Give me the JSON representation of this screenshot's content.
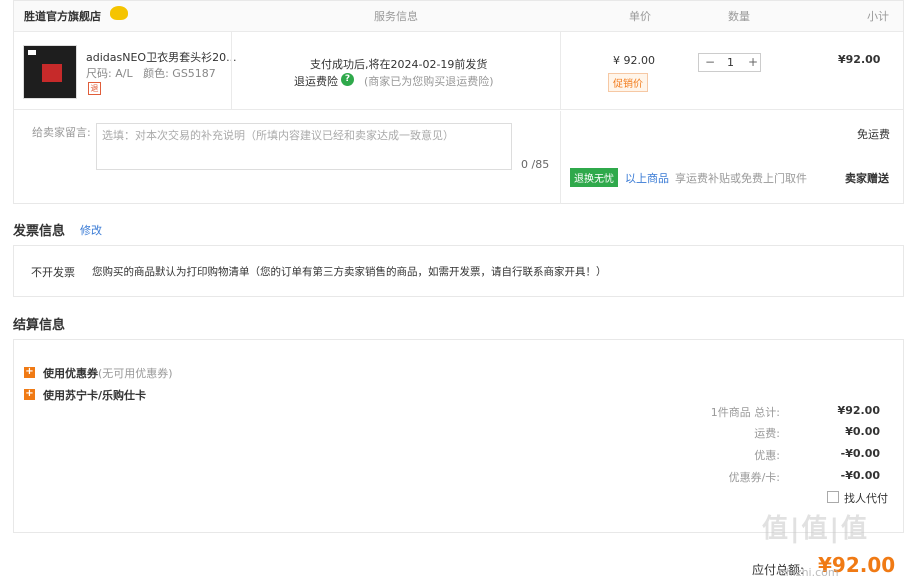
{
  "header": {
    "store_name": "胜道官方旗舰店",
    "col_service": "服务信息",
    "col_price": "单价",
    "col_qty": "数量",
    "col_subtotal": "小计"
  },
  "item": {
    "title": "adidasNEO卫衣男套头衫20...",
    "size_label": "尺码:",
    "size_value": "A/L",
    "color_label": "颜色:",
    "color_value": "GS5187",
    "return_tag": "退",
    "ship_notice": "支付成功后,将在2024-02-19前发货",
    "insurance_label": "退运费险",
    "insurance_note": "(商家已为您购买退运费险)",
    "price": "¥ 92.00",
    "promo_tag": "促销价",
    "qty": "1",
    "qty_minus": "−",
    "qty_plus": "+",
    "subtotal": "¥92.00"
  },
  "message": {
    "label": "给卖家留言:",
    "placeholder": "选填：对本次交易的补充说明（所填内容建议已经和卖家达成一致意见）",
    "counter": "0 /85",
    "shipping": "免运费",
    "green_tag": "退换无忧",
    "tag_link": "以上商品",
    "tag_desc": "享运费补贴或免费上门取件",
    "gift": "卖家赠送"
  },
  "invoice": {
    "title": "发票信息",
    "edit": "修改",
    "status": "不开发票",
    "note": "您购买的商品默认为打印购物清单（您的订单有第三方卖家销售的商品，如需开发票，请自行联系商家开具！）"
  },
  "settlement": {
    "title": "结算信息",
    "coupon_label": "使用优惠券",
    "coupon_note": "(无可用优惠券)",
    "card_label": "使用苏宁卡/乐购仕卡",
    "rows": [
      {
        "label": "1件商品 总计:",
        "value": "¥92.00"
      },
      {
        "label": "运费:",
        "value": "¥0.00"
      },
      {
        "label": "优惠:",
        "value": "-¥0.00"
      },
      {
        "label": "优惠券/卡:",
        "value": "-¥0.00"
      }
    ],
    "proxy_pay": "找人代付",
    "total_label": "应付总额:",
    "total_value": "¥92.00"
  },
  "watermark": {
    "logo": "值|值|值",
    "site": "zhizhi.com"
  },
  "colors": {
    "accent_orange": "#f07a14",
    "success_green": "#2fa94b",
    "link_blue": "#3a7bd5"
  }
}
